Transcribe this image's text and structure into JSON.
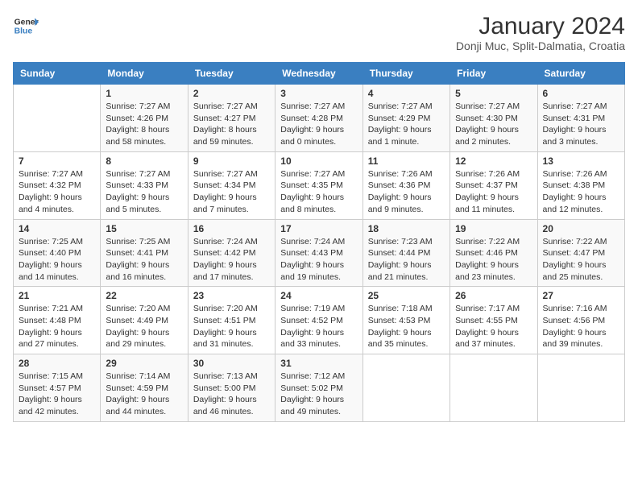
{
  "header": {
    "logo_line1": "General",
    "logo_line2": "Blue",
    "title": "January 2024",
    "subtitle": "Donji Muc, Split-Dalmatia, Croatia"
  },
  "days_of_week": [
    "Sunday",
    "Monday",
    "Tuesday",
    "Wednesday",
    "Thursday",
    "Friday",
    "Saturday"
  ],
  "weeks": [
    [
      {
        "date": "",
        "sunrise": "",
        "sunset": "",
        "daylight": ""
      },
      {
        "date": "1",
        "sunrise": "Sunrise: 7:27 AM",
        "sunset": "Sunset: 4:26 PM",
        "daylight": "Daylight: 8 hours and 58 minutes."
      },
      {
        "date": "2",
        "sunrise": "Sunrise: 7:27 AM",
        "sunset": "Sunset: 4:27 PM",
        "daylight": "Daylight: 8 hours and 59 minutes."
      },
      {
        "date": "3",
        "sunrise": "Sunrise: 7:27 AM",
        "sunset": "Sunset: 4:28 PM",
        "daylight": "Daylight: 9 hours and 0 minutes."
      },
      {
        "date": "4",
        "sunrise": "Sunrise: 7:27 AM",
        "sunset": "Sunset: 4:29 PM",
        "daylight": "Daylight: 9 hours and 1 minute."
      },
      {
        "date": "5",
        "sunrise": "Sunrise: 7:27 AM",
        "sunset": "Sunset: 4:30 PM",
        "daylight": "Daylight: 9 hours and 2 minutes."
      },
      {
        "date": "6",
        "sunrise": "Sunrise: 7:27 AM",
        "sunset": "Sunset: 4:31 PM",
        "daylight": "Daylight: 9 hours and 3 minutes."
      }
    ],
    [
      {
        "date": "7",
        "sunrise": "Sunrise: 7:27 AM",
        "sunset": "Sunset: 4:32 PM",
        "daylight": "Daylight: 9 hours and 4 minutes."
      },
      {
        "date": "8",
        "sunrise": "Sunrise: 7:27 AM",
        "sunset": "Sunset: 4:33 PM",
        "daylight": "Daylight: 9 hours and 5 minutes."
      },
      {
        "date": "9",
        "sunrise": "Sunrise: 7:27 AM",
        "sunset": "Sunset: 4:34 PM",
        "daylight": "Daylight: 9 hours and 7 minutes."
      },
      {
        "date": "10",
        "sunrise": "Sunrise: 7:27 AM",
        "sunset": "Sunset: 4:35 PM",
        "daylight": "Daylight: 9 hours and 8 minutes."
      },
      {
        "date": "11",
        "sunrise": "Sunrise: 7:26 AM",
        "sunset": "Sunset: 4:36 PM",
        "daylight": "Daylight: 9 hours and 9 minutes."
      },
      {
        "date": "12",
        "sunrise": "Sunrise: 7:26 AM",
        "sunset": "Sunset: 4:37 PM",
        "daylight": "Daylight: 9 hours and 11 minutes."
      },
      {
        "date": "13",
        "sunrise": "Sunrise: 7:26 AM",
        "sunset": "Sunset: 4:38 PM",
        "daylight": "Daylight: 9 hours and 12 minutes."
      }
    ],
    [
      {
        "date": "14",
        "sunrise": "Sunrise: 7:25 AM",
        "sunset": "Sunset: 4:40 PM",
        "daylight": "Daylight: 9 hours and 14 minutes."
      },
      {
        "date": "15",
        "sunrise": "Sunrise: 7:25 AM",
        "sunset": "Sunset: 4:41 PM",
        "daylight": "Daylight: 9 hours and 16 minutes."
      },
      {
        "date": "16",
        "sunrise": "Sunrise: 7:24 AM",
        "sunset": "Sunset: 4:42 PM",
        "daylight": "Daylight: 9 hours and 17 minutes."
      },
      {
        "date": "17",
        "sunrise": "Sunrise: 7:24 AM",
        "sunset": "Sunset: 4:43 PM",
        "daylight": "Daylight: 9 hours and 19 minutes."
      },
      {
        "date": "18",
        "sunrise": "Sunrise: 7:23 AM",
        "sunset": "Sunset: 4:44 PM",
        "daylight": "Daylight: 9 hours and 21 minutes."
      },
      {
        "date": "19",
        "sunrise": "Sunrise: 7:22 AM",
        "sunset": "Sunset: 4:46 PM",
        "daylight": "Daylight: 9 hours and 23 minutes."
      },
      {
        "date": "20",
        "sunrise": "Sunrise: 7:22 AM",
        "sunset": "Sunset: 4:47 PM",
        "daylight": "Daylight: 9 hours and 25 minutes."
      }
    ],
    [
      {
        "date": "21",
        "sunrise": "Sunrise: 7:21 AM",
        "sunset": "Sunset: 4:48 PM",
        "daylight": "Daylight: 9 hours and 27 minutes."
      },
      {
        "date": "22",
        "sunrise": "Sunrise: 7:20 AM",
        "sunset": "Sunset: 4:49 PM",
        "daylight": "Daylight: 9 hours and 29 minutes."
      },
      {
        "date": "23",
        "sunrise": "Sunrise: 7:20 AM",
        "sunset": "Sunset: 4:51 PM",
        "daylight": "Daylight: 9 hours and 31 minutes."
      },
      {
        "date": "24",
        "sunrise": "Sunrise: 7:19 AM",
        "sunset": "Sunset: 4:52 PM",
        "daylight": "Daylight: 9 hours and 33 minutes."
      },
      {
        "date": "25",
        "sunrise": "Sunrise: 7:18 AM",
        "sunset": "Sunset: 4:53 PM",
        "daylight": "Daylight: 9 hours and 35 minutes."
      },
      {
        "date": "26",
        "sunrise": "Sunrise: 7:17 AM",
        "sunset": "Sunset: 4:55 PM",
        "daylight": "Daylight: 9 hours and 37 minutes."
      },
      {
        "date": "27",
        "sunrise": "Sunrise: 7:16 AM",
        "sunset": "Sunset: 4:56 PM",
        "daylight": "Daylight: 9 hours and 39 minutes."
      }
    ],
    [
      {
        "date": "28",
        "sunrise": "Sunrise: 7:15 AM",
        "sunset": "Sunset: 4:57 PM",
        "daylight": "Daylight: 9 hours and 42 minutes."
      },
      {
        "date": "29",
        "sunrise": "Sunrise: 7:14 AM",
        "sunset": "Sunset: 4:59 PM",
        "daylight": "Daylight: 9 hours and 44 minutes."
      },
      {
        "date": "30",
        "sunrise": "Sunrise: 7:13 AM",
        "sunset": "Sunset: 5:00 PM",
        "daylight": "Daylight: 9 hours and 46 minutes."
      },
      {
        "date": "31",
        "sunrise": "Sunrise: 7:12 AM",
        "sunset": "Sunset: 5:02 PM",
        "daylight": "Daylight: 9 hours and 49 minutes."
      },
      {
        "date": "",
        "sunrise": "",
        "sunset": "",
        "daylight": ""
      },
      {
        "date": "",
        "sunrise": "",
        "sunset": "",
        "daylight": ""
      },
      {
        "date": "",
        "sunrise": "",
        "sunset": "",
        "daylight": ""
      }
    ]
  ]
}
